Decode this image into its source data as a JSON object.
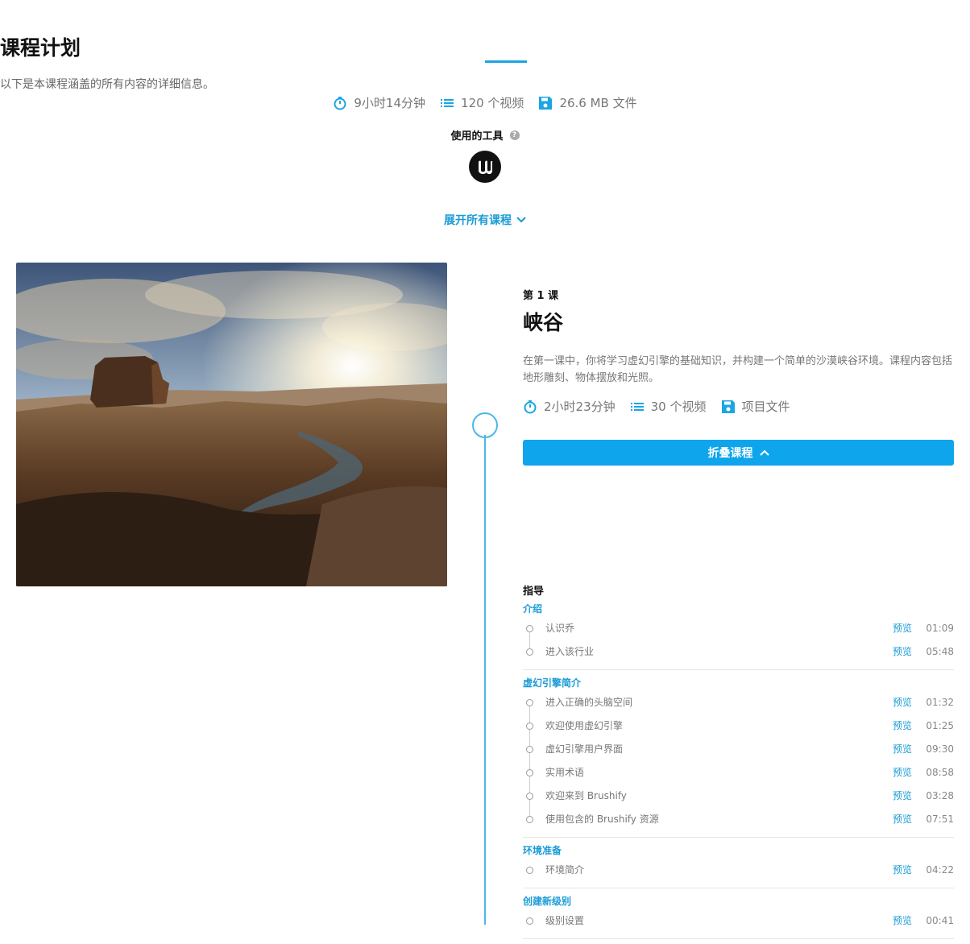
{
  "header": {
    "title": "课程计划",
    "subtitle": "以下是本课程涵盖的所有内容的详细信息。",
    "duration": "9小时14分钟",
    "videos": "120 个视频",
    "files": "26.6 MB 文件",
    "tools_label": "使用的工具",
    "help": "?",
    "expand_all": "展开所有课程"
  },
  "lesson": {
    "number": "第 1 课",
    "title": "峡谷",
    "description": "在第一课中，你将学习虚幻引擎的基础知识，并构建一个简单的沙漠峡谷环境。课程内容包括地形雕刻、物体摆放和光照。",
    "duration": "2小时23分钟",
    "videos": "30 个视频",
    "files": "项目文件",
    "collapse": "折叠课程"
  },
  "guide": {
    "title": "指导",
    "preview_label": "预览",
    "sections": [
      {
        "title": "介绍",
        "items": [
          {
            "label": "认识乔",
            "duration": "01:09"
          },
          {
            "label": "进入该行业",
            "duration": "05:48"
          }
        ]
      },
      {
        "title": "虚幻引擎简介",
        "items": [
          {
            "label": "进入正确的头脑空间",
            "duration": "01:32"
          },
          {
            "label": "欢迎使用虚幻引擎",
            "duration": "01:25"
          },
          {
            "label": "虚幻引擎用户界面",
            "duration": "09:30"
          },
          {
            "label": "实用术语",
            "duration": "08:58"
          },
          {
            "label": "欢迎来到 Brushify",
            "duration": "03:28"
          },
          {
            "label": "使用包含的 Brushify 资源",
            "duration": "07:51"
          }
        ]
      },
      {
        "title": "环境准备",
        "items": [
          {
            "label": "环境简介",
            "duration": "04:22"
          }
        ]
      },
      {
        "title": "创建新级别",
        "items": [
          {
            "label": "级别设置",
            "duration": "00:41"
          }
        ]
      }
    ]
  },
  "colors": {
    "accent": "#0ea5ec",
    "link": "#1a9bd6"
  }
}
